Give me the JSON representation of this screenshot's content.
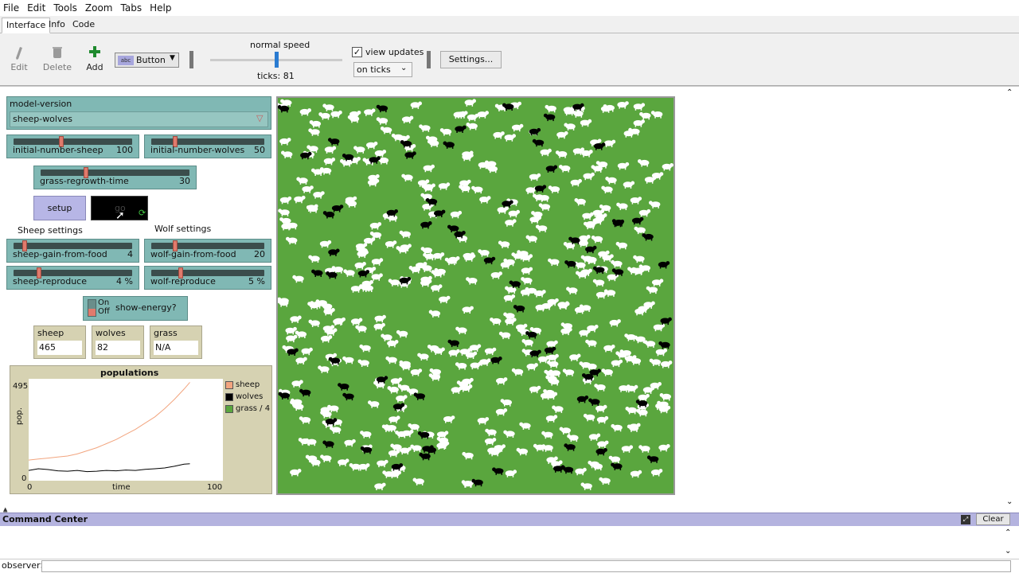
{
  "menu": [
    "File",
    "Edit",
    "Tools",
    "Zoom",
    "Tabs",
    "Help"
  ],
  "tabs": [
    "Interface",
    "Info",
    "Code"
  ],
  "toolbar": {
    "edit_label": "Edit",
    "delete_label": "Delete",
    "add_label": "Add",
    "widget_type": "Button",
    "widget_icon_text": "abc",
    "speed_label": "normal speed",
    "ticks_label": "ticks: 81",
    "speed_fraction": 0.5,
    "view_updates_label": "view updates",
    "view_updates_checked": true,
    "update_mode": "on ticks",
    "settings_label": "Settings..."
  },
  "chooser": {
    "label": "model-version",
    "value": "sheep-wolves"
  },
  "sliders": {
    "initial_number_sheep": {
      "name": "initial-number-sheep",
      "value": "100",
      "fraction": 0.4
    },
    "initial_number_wolves": {
      "name": "initial-number-wolves",
      "value": "50",
      "fraction": 0.2
    },
    "grass_regrowth_time": {
      "name": "grass-regrowth-time",
      "value": "30",
      "fraction": 0.3
    },
    "sheep_gain_from_food": {
      "name": "sheep-gain-from-food",
      "value": "4",
      "fraction": 0.08
    },
    "sheep_reproduce": {
      "name": "sheep-reproduce",
      "value": "4 %",
      "fraction": 0.2
    },
    "wolf_gain_from_food": {
      "name": "wolf-gain-from-food",
      "value": "20",
      "fraction": 0.2
    },
    "wolf_reproduce": {
      "name": "wolf-reproduce",
      "value": "5 %",
      "fraction": 0.25
    }
  },
  "buttons": {
    "setup_label": "setup",
    "go_label": "go"
  },
  "section_labels": {
    "sheep_settings": "Sheep settings",
    "wolf_settings": "Wolf settings"
  },
  "switch": {
    "on_label": "On",
    "off_label": "Off",
    "name": "show-energy?",
    "state": "off"
  },
  "monitors": {
    "sheep": {
      "label": "sheep",
      "value": "465"
    },
    "wolves": {
      "label": "wolves",
      "value": "82"
    },
    "grass": {
      "label": "grass",
      "value": "N/A"
    }
  },
  "colors": {
    "grass_green": "#5aa63e",
    "sheep_color": "#f2a57f",
    "wolves_color": "#000000",
    "grass_series_color": "#5aa63e",
    "teal_widget": "#80b8b4",
    "button_lavender": "#b7b6e6"
  },
  "chart_data": {
    "type": "line",
    "title": "populations",
    "xlabel": "time",
    "ylabel": "pop.",
    "xlim": [
      0,
      100
    ],
    "ylim": [
      0,
      495
    ],
    "x_ticks": [
      "0",
      "100"
    ],
    "y_ticks": [
      "0",
      "495"
    ],
    "legend": "right",
    "series": [
      {
        "name": "sheep",
        "x": [
          0,
          5,
          10,
          15,
          20,
          25,
          30,
          35,
          40,
          45,
          50,
          55,
          60,
          65,
          70,
          75,
          80,
          83
        ],
        "values": [
          100,
          105,
          110,
          115,
          120,
          130,
          145,
          160,
          180,
          200,
          225,
          250,
          280,
          310,
          350,
          395,
          445,
          478
        ]
      },
      {
        "name": "wolves",
        "x": [
          0,
          5,
          10,
          15,
          20,
          25,
          30,
          35,
          40,
          45,
          50,
          55,
          60,
          65,
          70,
          75,
          80,
          83
        ],
        "values": [
          50,
          58,
          54,
          48,
          46,
          50,
          44,
          46,
          50,
          48,
          52,
          50,
          55,
          58,
          62,
          70,
          80,
          82
        ]
      },
      {
        "name": "grass / 4",
        "x": [],
        "values": []
      }
    ]
  },
  "command_center": {
    "title": "Command Center",
    "clear_label": "Clear",
    "prompt": "observer>"
  }
}
